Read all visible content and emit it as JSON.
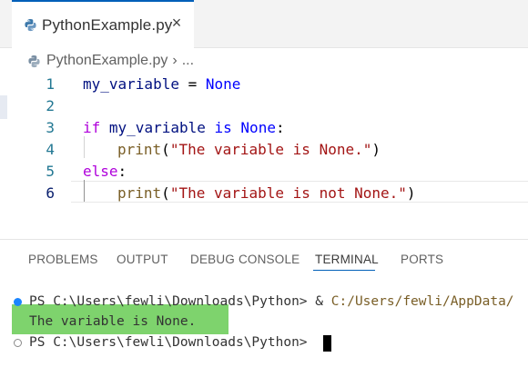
{
  "tab": {
    "label": "PythonExample.py",
    "close_glyph": "×",
    "icon": "python-icon"
  },
  "breadcrumb": {
    "file": "PythonExample.py",
    "separator": "›",
    "more": "..."
  },
  "editor": {
    "lines": [
      {
        "number": "1"
      },
      {
        "number": "2"
      },
      {
        "number": "3"
      },
      {
        "number": "4"
      },
      {
        "number": "5"
      },
      {
        "number": "6"
      }
    ],
    "code": {
      "l1_var": "my_variable",
      "l1_eq": " = ",
      "l1_none": "None",
      "l3_if": "if",
      "l3_sp1": " ",
      "l3_var": "my_variable",
      "l3_sp2": " ",
      "l3_is": "is",
      "l3_sp3": " ",
      "l3_none": "None",
      "l3_colon": ":",
      "l4_print": "print",
      "l4_open": "(",
      "l4_str": "\"The variable is None.\"",
      "l4_close": ")",
      "l5_else": "else",
      "l5_colon": ":",
      "l6_print": "print",
      "l6_open": "(",
      "l6_str": "\"The variable is not None.\"",
      "l6_close": ")"
    }
  },
  "panel": {
    "tabs": [
      {
        "label": "PROBLEMS"
      },
      {
        "label": "OUTPUT"
      },
      {
        "label": "DEBUG CONSOLE"
      },
      {
        "label": "TERMINAL"
      },
      {
        "label": "PORTS"
      }
    ],
    "active_tab": "TERMINAL"
  },
  "terminal": {
    "prompt1": "PS C:\\Users\\fewli\\Downloads\\Python> ",
    "cmd_amp": "& ",
    "cmd_path": "C:/Users/fewli/AppData/",
    "output": "The variable is None.",
    "prompt2": "PS C:\\Users\\fewli\\Downloads\\Python> ",
    "highlight_color": "#7ed36d"
  },
  "colors": {
    "accent": "#005fb8",
    "keyword_blue": "#0000ff",
    "keyword_purple": "#af00db",
    "string": "#a31515",
    "function": "#795e26",
    "variable": "#001080",
    "line_number": "#237893"
  }
}
